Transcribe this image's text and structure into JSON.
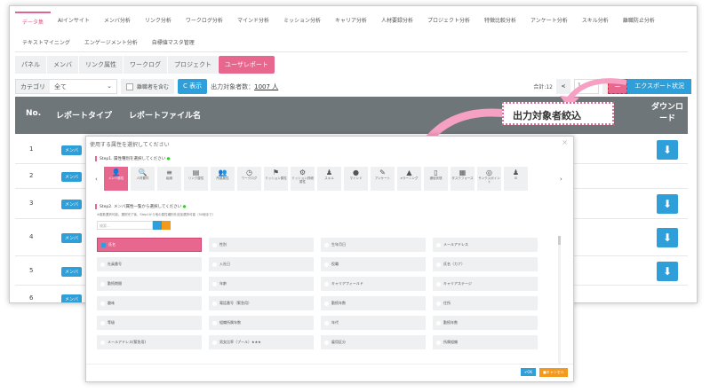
{
  "main_tabs": [
    "データ集",
    "AIインサイト",
    "メンバ分析",
    "リンク分析",
    "ワークログ分析",
    "マインド分析",
    "ミッション分析",
    "キャリア分析",
    "人材要録分析",
    "プロジェクト分析",
    "特徴比較分析",
    "アンケート分析",
    "スキル分析",
    "離職防止分析",
    "テキストマイニング",
    "エンゲージメント分析",
    "自標値マスタ管理"
  ],
  "sub_tabs": [
    "パネル",
    "メンバ",
    "リンク属性",
    "ワークログ",
    "プロジェクト",
    "ユーザレポート"
  ],
  "filter": {
    "category_label": "カテゴリ",
    "category_value": "全て",
    "include_retired": "離職者を含む",
    "show_button": "C 表示",
    "count_label": "出力対象者数：",
    "count_value": "1007 人"
  },
  "pager": {
    "total": "合計:12",
    "prev": "<",
    "page": "1",
    "next": ">"
  },
  "export_button": "エクスポート状況",
  "pink_button": "ー",
  "table": {
    "headers": [
      "No.",
      "レポートタイプ",
      "レポートファイル名",
      "ダウンロード"
    ],
    "rows": [
      {
        "no": "1",
        "type": "メンバ"
      },
      {
        "no": "2",
        "type": "メンバ"
      },
      {
        "no": "3",
        "type": "メンバ"
      },
      {
        "no": "4",
        "type": "メンバ"
      },
      {
        "no": "5",
        "type": "メンバ"
      },
      {
        "no": "6",
        "type": "メンバ"
      }
    ]
  },
  "callout": "出力対象者絞込",
  "modal": {
    "title": "使用する属性を選択してください",
    "close": "×",
    "step1": "Step1. 属性種別を選択してください",
    "step2": "Step2. メンバ属性一覧から選択してください",
    "note": "※複数選択可能。選択完了後、Step1から他の属性種別を追加選択可能（50個まで）",
    "search_placeholder": "検索...",
    "categories": [
      "メンバ属性",
      "人材要件",
      "組織",
      "リンク属性",
      "所属属性",
      "ワークログ",
      "ミッション属性",
      "ミッション詳細属性",
      "スキル",
      "マインド",
      "アンケート",
      "eラーニング",
      "通信状態",
      "タスクフォース",
      "サンクスポイント",
      "Sl"
    ],
    "attributes": [
      "氏名",
      "性別",
      "生年月日",
      "メールアドレス",
      "社員番号",
      "入社日",
      "役職",
      "氏名（カナ）",
      "勤続期間",
      "年齢",
      "キャリアフィールド",
      "キャリアステージ",
      "趣味",
      "電話番号（緊急用）",
      "勤続年数",
      "住所",
      "等級",
      "組織所属年数",
      "年代",
      "勤続年数",
      "メールアドレス(緊急用)",
      "男女比率（プール）★★★",
      "雇用区分",
      "所属組織"
    ],
    "ok": "✔OK",
    "cancel": "■キャンセル"
  },
  "colors": {
    "accent_pink": "#e8678f",
    "primary_blue": "#2e9fd8",
    "cancel_orange": "#f39a1d",
    "header_gray": "#6f7679"
  }
}
